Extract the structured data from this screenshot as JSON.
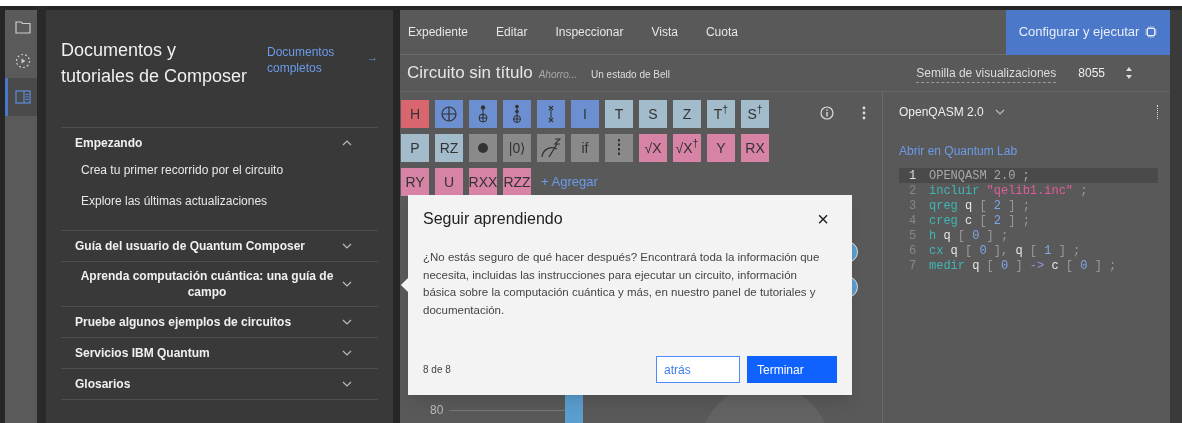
{
  "rail": [
    {
      "kind": "folder",
      "selected": false
    },
    {
      "kind": "play",
      "selected": false
    },
    {
      "kind": "docs",
      "selected": true
    }
  ],
  "docs_panel": {
    "title": "Documentos y tutoriales de Composer",
    "link": "Documentos completos",
    "link_arrow": "→",
    "sections": [
      {
        "label": "Empezando",
        "expanded": true,
        "children": [
          {
            "label": "Crea tu primer recorrido por el circuito"
          },
          {
            "label": "Explore las últimas actualizaciones"
          }
        ]
      },
      {
        "label": "Guía del usuario de Quantum Composer",
        "expanded": false
      },
      {
        "label": "Aprenda computación cuántica: una guía de campo",
        "expanded": false,
        "centered": true
      },
      {
        "label": "Pruebe algunos ejemplos de circuitos",
        "expanded": false
      },
      {
        "label": "Servicios IBM Quantum",
        "expanded": false
      },
      {
        "label": "Glosarios",
        "expanded": false
      }
    ]
  },
  "menu": [
    "Expediente",
    "Editar",
    "Inspeccionar",
    "Vista",
    "Cuota"
  ],
  "run_button": "Configurar y ejecutar",
  "circuit": {
    "title": "Circuito sin título",
    "saving": "Ahorro...",
    "description": "Un estado de Bell"
  },
  "seed": {
    "label": "Semilla de visualizaciones",
    "value": "8055"
  },
  "gates": [
    [
      {
        "kind": "text",
        "label": "H",
        "color": "#d9666e"
      },
      {
        "kind": "plus",
        "color": "#6b8fd1"
      },
      {
        "kind": "cnot",
        "color": "#6b8fd1"
      },
      {
        "kind": "toffoli",
        "color": "#6b8fd1"
      },
      {
        "kind": "swap",
        "color": "#6b8fd1"
      },
      {
        "kind": "text",
        "label": "I",
        "color": "#6b8fd1"
      },
      {
        "kind": "text",
        "label": "T",
        "color": "#a3bccb"
      },
      {
        "kind": "text",
        "label": "S",
        "color": "#a3bccb"
      },
      {
        "kind": "text",
        "label": "Z",
        "color": "#a3bccb"
      },
      {
        "kind": "text",
        "label": "T$^{†}$",
        "color": "#a3bccb"
      },
      {
        "kind": "text",
        "label": "S$^{†}$",
        "color": "#a3bccb"
      }
    ],
    [
      {
        "kind": "text",
        "label": "P",
        "color": "#a3bccb"
      },
      {
        "kind": "text",
        "label": "RZ",
        "color": "#a3bccb"
      },
      {
        "kind": "dot",
        "color": "#8a8a8a"
      },
      {
        "kind": "text",
        "label": "|0⟩",
        "color": "#8a8a8a"
      },
      {
        "kind": "measure",
        "color": "#8a8a8a"
      },
      {
        "kind": "text",
        "label": "if",
        "color": "#8a8a8a"
      },
      {
        "kind": "barrier",
        "color": "#8a8a8a"
      },
      {
        "kind": "text",
        "label": "√X",
        "color": "#d783a5"
      },
      {
        "kind": "text",
        "label": "√X$^{†}$",
        "color": "#d783a5"
      },
      {
        "kind": "text",
        "label": "Y",
        "color": "#d783a5"
      },
      {
        "kind": "text",
        "label": "RX",
        "color": "#d783a5"
      }
    ],
    [
      {
        "kind": "text",
        "label": "RY",
        "color": "#d783a5"
      },
      {
        "kind": "text",
        "label": "U",
        "color": "#d783a5"
      },
      {
        "kind": "text",
        "label": "RXX",
        "color": "#d783a5"
      },
      {
        "kind": "text",
        "label": "RZZ",
        "color": "#d783a5"
      }
    ]
  ],
  "add_gate": "+ Agregar",
  "chart_tick": "80",
  "code_panel": {
    "language": "OpenQASM 2.0",
    "open_link": "Abrir en Quantum Lab",
    "lines": [
      {
        "number": "1",
        "current": true,
        "tokens": [
          {
            "kind": "plain",
            "text": "OPENQASM 2.0 ;"
          }
        ]
      },
      {
        "number": "2",
        "current": false,
        "tokens": [
          {
            "kind": "keyword",
            "text": "incluir"
          },
          {
            "kind": "string",
            "text": "\"qelib1.inc\""
          },
          {
            "kind": "punct",
            "text": ";"
          }
        ]
      },
      {
        "number": "3",
        "current": false,
        "tokens": [
          {
            "kind": "keyword",
            "text": "qreg"
          },
          {
            "kind": "ident",
            "text": "q"
          },
          {
            "kind": "punct",
            "text": "["
          },
          {
            "kind": "number",
            "text": "2"
          },
          {
            "kind": "punct",
            "text": "] ;"
          }
        ]
      },
      {
        "number": "4",
        "current": false,
        "tokens": [
          {
            "kind": "keyword",
            "text": "creg"
          },
          {
            "kind": "ident",
            "text": "c"
          },
          {
            "kind": "punct",
            "text": "["
          },
          {
            "kind": "number",
            "text": "2"
          },
          {
            "kind": "punct",
            "text": "] ;"
          }
        ]
      },
      {
        "number": "5",
        "current": false,
        "tokens": [
          {
            "kind": "keyword",
            "text": "h"
          },
          {
            "kind": "ident",
            "text": "q"
          },
          {
            "kind": "punct",
            "text": "["
          },
          {
            "kind": "number",
            "text": "0"
          },
          {
            "kind": "punct",
            "text": "] ;"
          }
        ]
      },
      {
        "number": "6",
        "current": false,
        "tokens": [
          {
            "kind": "keyword",
            "text": "cx"
          },
          {
            "kind": "ident",
            "text": "q"
          },
          {
            "kind": "punct",
            "text": "["
          },
          {
            "kind": "number",
            "text": "0"
          },
          {
            "kind": "punct",
            "text": "],"
          },
          {
            "kind": "ident",
            "text": "q"
          },
          {
            "kind": "punct",
            "text": "["
          },
          {
            "kind": "number",
            "text": "1"
          },
          {
            "kind": "punct",
            "text": "] ;"
          }
        ]
      },
      {
        "number": "7",
        "current": false,
        "tokens": [
          {
            "kind": "keyword",
            "text": "medir"
          },
          {
            "kind": "ident",
            "text": "q"
          },
          {
            "kind": "punct",
            "text": "["
          },
          {
            "kind": "number",
            "text": "0"
          },
          {
            "kind": "punct",
            "text": "]"
          },
          {
            "kind": "op",
            "text": "->"
          },
          {
            "kind": "ident",
            "text": "c"
          },
          {
            "kind": "punct",
            "text": "["
          },
          {
            "kind": "number",
            "text": "0"
          },
          {
            "kind": "punct",
            "text": "] ;"
          }
        ]
      }
    ]
  },
  "dialog": {
    "title": "Seguir aprendiendo",
    "close": "×",
    "body": "¿No estás seguro de qué hacer después? Encontrará toda la información que necesita, incluidas las instrucciones para ejecutar un circuito, información básica sobre la computación cuántica y más, en nuestro panel de tutoriales y documentación.",
    "step": "8 de 8",
    "back": "atrás",
    "finish": "Terminar"
  }
}
